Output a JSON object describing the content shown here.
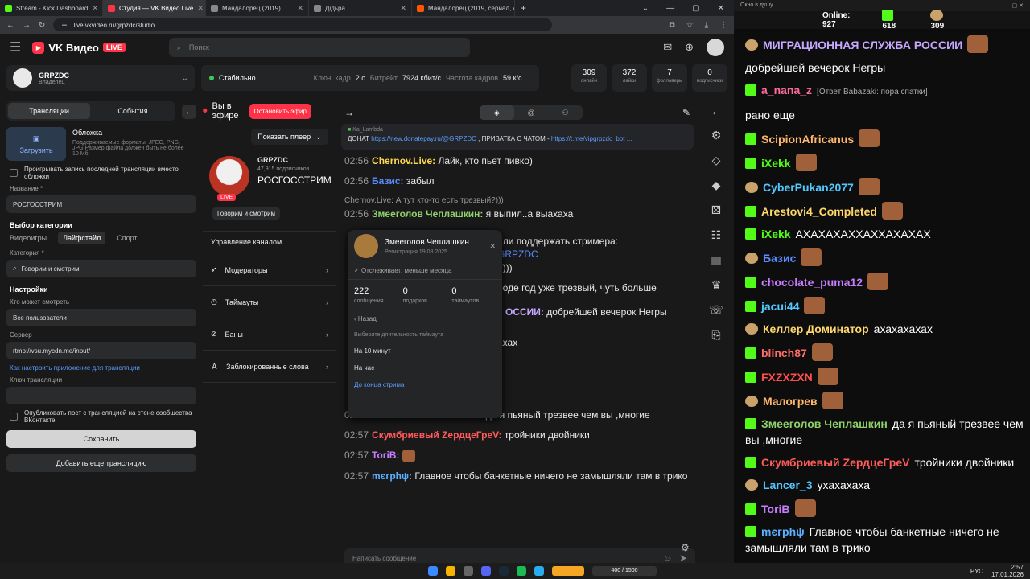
{
  "browser": {
    "tabs": [
      {
        "label": "Stream - Kick Dashboard",
        "color": "#53fc18"
      },
      {
        "label": "Студия — VK Видео Live",
        "color": "#ff3347"
      },
      {
        "label": "Мандалорец (2019)",
        "color": "#888"
      },
      {
        "label": "Дідьра",
        "color": "#888"
      },
      {
        "label": "Мандалорец (2019, сериал, 4...",
        "color": "#ff5500"
      }
    ],
    "url": "live.vkvideo.ru/grpzdc/studio"
  },
  "header": {
    "brand": "VK Видео",
    "live": "LIVE",
    "search_placeholder": "Поиск"
  },
  "channel": {
    "name": "GRPZDC",
    "role": "Владелец"
  },
  "stream": {
    "status": "Стабильно",
    "key_label": "Ключ. кадр",
    "key_val": "2 с",
    "bitrate_label": "Битрейт",
    "bitrate_val": "7924 кбит/с",
    "fps_label": "Частота кадров",
    "fps_val": "59 к/с"
  },
  "stats": [
    {
      "v": "309",
      "l": "онлайн"
    },
    {
      "v": "372",
      "l": "лайки"
    },
    {
      "v": "7",
      "l": "фолловеры"
    },
    {
      "v": "0",
      "l": "подписчики"
    }
  ],
  "left": {
    "tab1": "Трансляции",
    "tab2": "События",
    "cover": "Обложка",
    "upload": "Загрузить",
    "formats": "Поддерживаемые форматы: JPEG, PNG, JPG Размер файла должен быть не более 10 Мб",
    "record": "Проигрывать запись последней трансляции вместо обложки",
    "title_label": "Название *",
    "title_val": "РОСГОССТРИМ",
    "cat_head": "Выбор категории",
    "cats": [
      "Видеоигры",
      "Лайфстайл",
      "Спорт"
    ],
    "cat_label": "Категория *",
    "cat_val": "Говорим и смотрим",
    "settings": "Настройки",
    "who_label": "Кто может смотреть",
    "who_val": "Все пользователи",
    "server_label": "Сервер",
    "server_val": "rtmp://vsu.mycdn.me/input/",
    "howto": "Как настроить приложение для трансляции",
    "key_label": "Ключ трансляции",
    "key_val": "········································",
    "publish": "Опубликовать пост с трансляцией на стене сообщества ВКонтакте",
    "save": "Сохранить",
    "add": "Добавить еще трансляцию"
  },
  "mid": {
    "onair": "Вы в эфире",
    "stop": "Остановить эфир",
    "show": "Показать плеер",
    "name": "GRPZDC",
    "subs": "47,915 подписчиков",
    "title": "РОСГОССТРИМ",
    "category": "Говорим и смотрим",
    "live": "LIVE",
    "manage": "Управление каналом",
    "rows": [
      "Модераторы",
      "Таймауты",
      "Баны",
      "Заблокированные слова"
    ]
  },
  "chat": {
    "pinned_by": "Ka_Lambda",
    "pinned_text": "ДОНАТ ",
    "pinned_link": "https://new.donatepay.ru/@GRPZDC",
    "pinned_rest": " , ПРИВАТКА С ЧАТОМ - ",
    "pinned_link2": "https://t.me/vipgrpzdc_bot ...",
    "m1t": "02:56",
    "m1n": "Chernov.Live:",
    "m1": "Лайк, кто пьет пивко)",
    "m2t": "02:56",
    "m2n": "Базис:",
    "m2": "забыл",
    "m3r": "Chernov.Live: А тут кто-то есть трезвый?)))",
    "m3t": "02:56",
    "m3n": "Змееголов Чеплашкин:",
    "m3": "я выпил..а выахаха",
    "m4": "или поддержать стримера:",
    "m4l": "GRPZDC",
    "m5": "?)))",
    "m6": "роде год уже трезвый, чуть больше",
    "m7n": "ОССИИ:",
    "m7": "добрейшей вечерок Негры",
    "m8": "ахах",
    "m9t": "02:57",
    "m9n": "Змееголов Чеплашкин:",
    "m9": "да я пьяный трезвее чем вы ,многие",
    "m10t": "02:57",
    "m10n": "Скумбриевый ZердцеГреV:",
    "m10": "тройники двойники",
    "m11t": "02:57",
    "m11n": "ToriB:",
    "m12t": "02:57",
    "m12n": "mєгрhψ:",
    "m12": "Главное чтобы банкетные ничего не замышляли там в трико",
    "placeholder": "Написать сообщение"
  },
  "popup": {
    "name": "Змееголов Чеплашкин",
    "reg": "Регистрация 19.08.2025",
    "tracking": "Отслеживает: меньше месяца",
    "s": [
      {
        "v": "222",
        "l": "сообщения"
      },
      {
        "v": "0",
        "l": "подарков"
      },
      {
        "v": "0",
        "l": "таймаутов"
      }
    ],
    "back": "Назад",
    "choose": "Выберите длительность таймаута",
    "o1": "На 10 минут",
    "o2": "На час",
    "o3": "До конца стрима"
  },
  "kick": {
    "title": "Окно в душу",
    "online_label": "Online:",
    "online": "927",
    "a": "618",
    "b": "309",
    "rows": [
      {
        "n": "МИГРАЦИОННАЯ СЛУЖБА РОССИИ",
        "t": "",
        "c": "#c6a8ff"
      },
      {
        "n": "",
        "t": "добрейшей вечерок Негры",
        "c": "#fff"
      },
      {
        "n": "a_nana_z",
        "t": "[Ответ Babazaki: пора спатки]",
        "c": "#ff6b9a"
      },
      {
        "n": "",
        "t": "рано еще",
        "c": "#fff"
      },
      {
        "n": "ScipionAfricanus",
        "t": "",
        "c": "#ffb86b"
      },
      {
        "n": "iXekk",
        "t": "",
        "c": "#53fc18"
      },
      {
        "n": "CyberPukan2077",
        "t": "",
        "c": "#53c7ff"
      },
      {
        "n": "Arestovi4_Completed",
        "t": "",
        "c": "#ffd76b"
      },
      {
        "n": "iXekk",
        "t": "АХАХАХАХХАХХАХАХАХ",
        "c": "#53fc18"
      },
      {
        "n": "Базис",
        "t": "",
        "c": "#5b8dff"
      },
      {
        "n": "chocolate_puma12",
        "t": "",
        "c": "#c77dff"
      },
      {
        "n": "jacui44",
        "t": "",
        "c": "#53c7ff"
      },
      {
        "n": "Келлер Доминатор",
        "t": "ахахахахах",
        "c": "#ffd76b"
      },
      {
        "n": "blinch87",
        "t": "",
        "c": "#ff6b6b"
      },
      {
        "n": "FXZXZXN",
        "t": "",
        "c": "#ff4d4d"
      },
      {
        "n": "Малогрев",
        "t": "",
        "c": "#ffb86b"
      },
      {
        "n": "Змееголов Чеплашкин",
        "t": "да я пьяный трезвее чем вы ,многие",
        "c": "#8fd16b"
      },
      {
        "n": "Скумбриевый ZердцеГреV",
        "t": "тройники двойники",
        "c": "#ff5b5b"
      },
      {
        "n": "Lancer_3",
        "t": "ухахахаха",
        "c": "#53c7ff"
      },
      {
        "n": "ToriB",
        "t": "",
        "c": "#c77dff"
      },
      {
        "n": "mєгрhψ",
        "t": "Главное чтобы банкетные ничего не замышляли там в трико",
        "c": "#5bb0ff"
      }
    ]
  },
  "taskbar": {
    "lang": "РУС",
    "time": "2:57",
    "date": "17.01.2026",
    "game": "400 / 1500"
  }
}
